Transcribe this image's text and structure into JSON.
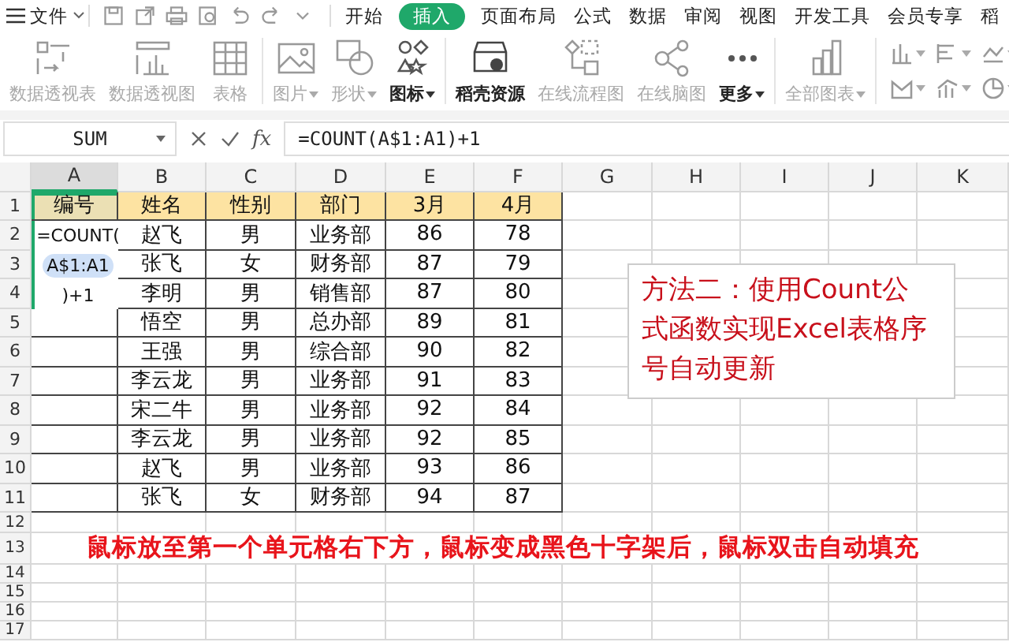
{
  "menu_bar": {
    "app_menu": "文件",
    "tabs": [
      {
        "label": "开始",
        "selected": false
      },
      {
        "label": "插入",
        "selected": true
      },
      {
        "label": "页面布局",
        "selected": false
      },
      {
        "label": "公式",
        "selected": false
      },
      {
        "label": "数据",
        "selected": false
      },
      {
        "label": "审阅",
        "selected": false
      },
      {
        "label": "视图",
        "selected": false
      },
      {
        "label": "开发工具",
        "selected": false
      },
      {
        "label": "会员专享",
        "selected": false
      },
      {
        "label": "稻",
        "selected": false
      }
    ]
  },
  "ribbon": {
    "groups": [
      [
        {
          "label": "数据透视表",
          "disabled": true,
          "dropdown": false
        },
        {
          "label": "数据透视图",
          "disabled": true,
          "dropdown": false
        },
        {
          "label": "表格",
          "disabled": true,
          "dropdown": false
        }
      ],
      [
        {
          "label": "图片",
          "disabled": true,
          "dropdown": true
        },
        {
          "label": "形状",
          "disabled": true,
          "dropdown": true
        },
        {
          "label": "图标",
          "disabled": false,
          "dropdown": true
        }
      ],
      [
        {
          "label": "稻壳资源",
          "disabled": false,
          "dropdown": false
        },
        {
          "label": "在线流程图",
          "disabled": true,
          "dropdown": false
        },
        {
          "label": "在线脑图",
          "disabled": true,
          "dropdown": false
        },
        {
          "label": "更多",
          "disabled": false,
          "dropdown": true
        }
      ],
      [
        {
          "label": "全部图表",
          "disabled": true,
          "dropdown": true
        }
      ]
    ]
  },
  "formula_bar": {
    "name_box": "SUM",
    "fx": "fx",
    "formula": "=COUNT(A$1:A1)+1"
  },
  "sheet": {
    "columns": [
      {
        "label": "A",
        "selected": true
      },
      {
        "label": "B",
        "selected": false
      },
      {
        "label": "C",
        "selected": false
      },
      {
        "label": "D",
        "selected": false
      },
      {
        "label": "E",
        "selected": false
      },
      {
        "label": "F",
        "selected": false
      },
      {
        "label": "G",
        "selected": false
      },
      {
        "label": "H",
        "selected": false
      },
      {
        "label": "I",
        "selected": false
      },
      {
        "label": "J",
        "selected": false
      },
      {
        "label": "K",
        "selected": false
      }
    ],
    "header_row": {
      "number": "1",
      "cells": [
        "编号",
        "姓名",
        "性别",
        "部门",
        "3月",
        "4月"
      ]
    },
    "rows": [
      {
        "number": "2",
        "cells": [
          "",
          "赵飞",
          "男",
          "业务部",
          "86",
          "78"
        ]
      },
      {
        "number": "3",
        "cells": [
          "",
          "张飞",
          "女",
          "财务部",
          "87",
          "79"
        ]
      },
      {
        "number": "4",
        "cells": [
          "",
          "李明",
          "男",
          "销售部",
          "87",
          "80"
        ]
      },
      {
        "number": "5",
        "cells": [
          "",
          "悟空",
          "男",
          "总办部",
          "89",
          "81"
        ]
      },
      {
        "number": "6",
        "cells": [
          "",
          "王强",
          "男",
          "综合部",
          "90",
          "82"
        ]
      },
      {
        "number": "7",
        "cells": [
          "",
          "李云龙",
          "男",
          "业务部",
          "91",
          "83"
        ]
      },
      {
        "number": "8",
        "cells": [
          "",
          "宋二牛",
          "男",
          "业务部",
          "92",
          "84"
        ]
      },
      {
        "number": "9",
        "cells": [
          "",
          "李云龙",
          "男",
          "业务部",
          "92",
          "85"
        ]
      },
      {
        "number": "10",
        "cells": [
          "",
          "赵飞",
          "男",
          "业务部",
          "93",
          "86"
        ]
      },
      {
        "number": "11",
        "cells": [
          "",
          "张飞",
          "女",
          "财务部",
          "94",
          "87"
        ]
      }
    ],
    "empty_rows": [
      "12",
      "13",
      "14",
      "15",
      "16",
      "17"
    ],
    "cell_editor": {
      "before": "=COUNT(",
      "reference": "A$1:A1",
      "after": ")+1"
    },
    "note_box": "方法二：使用Count公式函数实现Excel表格序号自动更新",
    "caption": "鼠标放至第一个单元格右下方，鼠标变成黑色十字架后，鼠标双击自动填充"
  }
}
